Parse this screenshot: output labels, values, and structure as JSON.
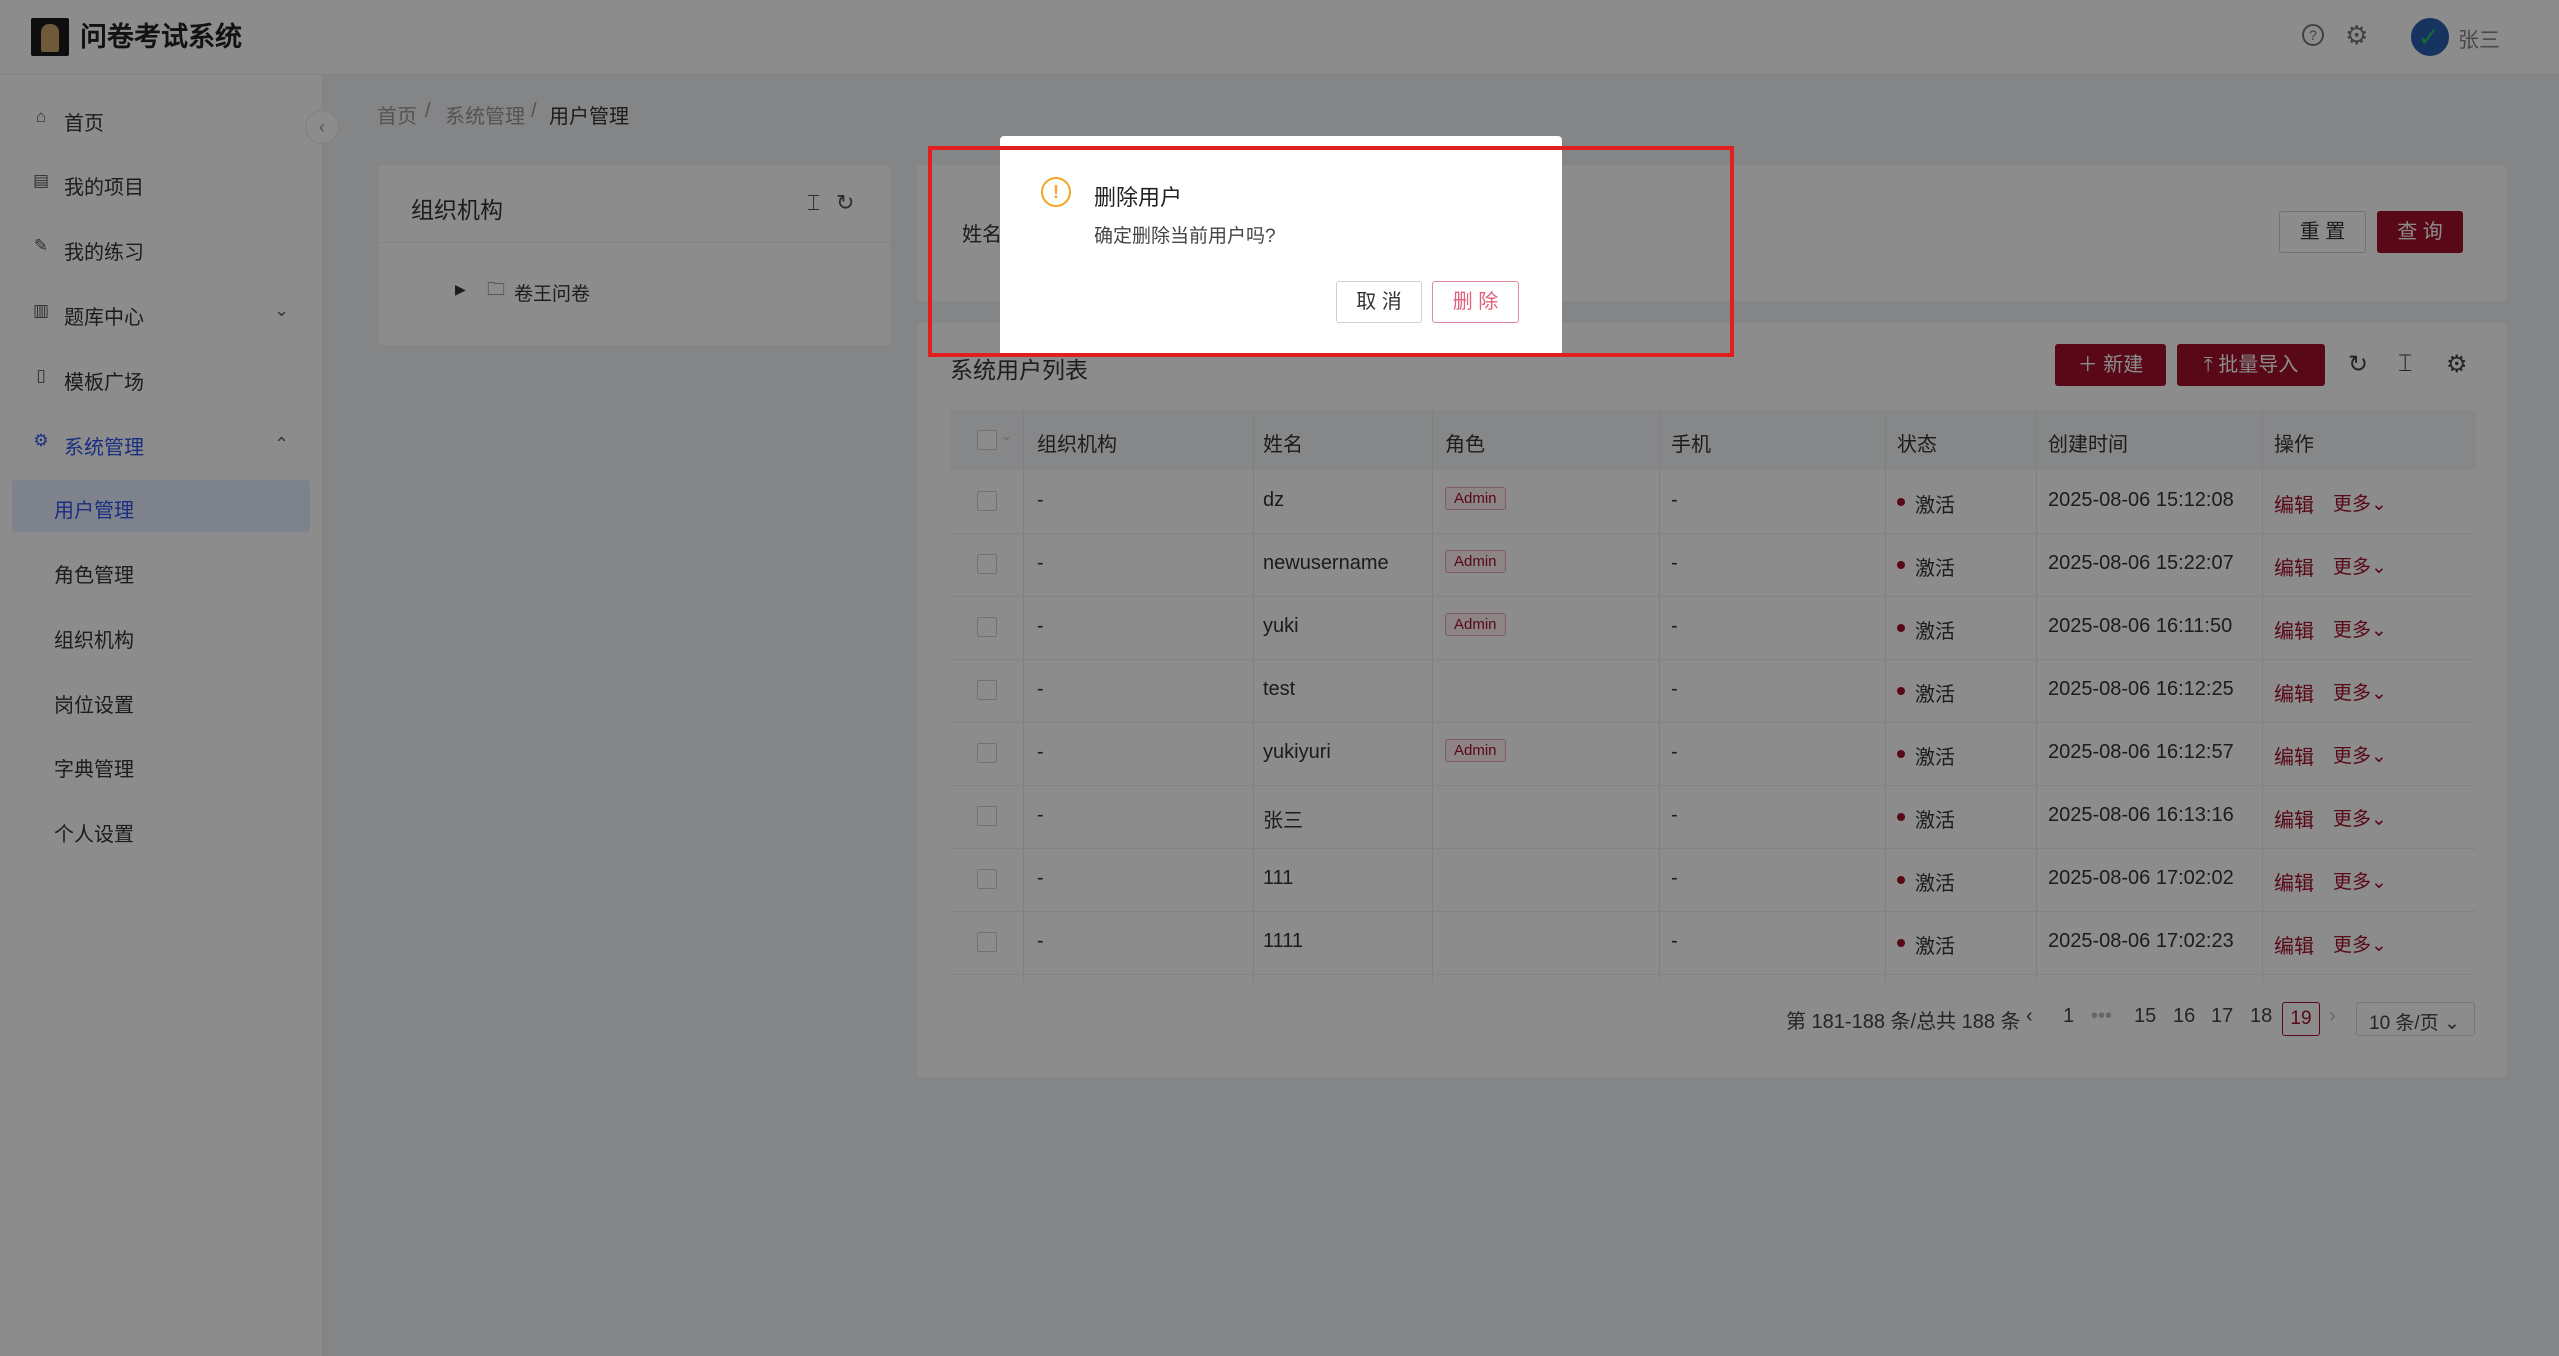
{
  "app": {
    "title": "问卷考试系统",
    "user": "张三"
  },
  "header": {
    "help_icon": "question-circle-icon",
    "settings_icon": "gear-icon"
  },
  "sidebar": {
    "collapse_icon": "‹",
    "items": [
      {
        "label": "首页",
        "icon": "home-icon"
      },
      {
        "label": "我的项目",
        "icon": "project-icon"
      },
      {
        "label": "我的练习",
        "icon": "edit-icon"
      },
      {
        "label": "题库中心",
        "icon": "book-icon"
      },
      {
        "label": "模板广场",
        "icon": "template-icon"
      },
      {
        "label": "系统管理",
        "icon": "settings-icon"
      }
    ],
    "sub_items": [
      "用户管理",
      "角色管理",
      "组织机构",
      "岗位设置",
      "字典管理",
      "个人设置"
    ]
  },
  "breadcrumb": [
    "首页",
    "系统管理",
    "用户管理"
  ],
  "org_panel": {
    "title": "组织机构",
    "tree_root": "卷王问卷"
  },
  "search": {
    "name_label": "姓名",
    "reset": "重 置",
    "query": "查 询"
  },
  "list": {
    "title": "系统用户列表",
    "new_button": "新建",
    "import_button": "批量导入",
    "columns": [
      "组织机构",
      "姓名",
      "角色",
      "手机",
      "状态",
      "创建时间",
      "操作"
    ],
    "rows": [
      {
        "org": "-",
        "name": "dz",
        "role": "Admin",
        "phone": "-",
        "status": "激活",
        "created": "2025-08-06 15:12:08",
        "edit": "编辑",
        "more": "更多"
      },
      {
        "org": "-",
        "name": "newusername",
        "role": "Admin",
        "phone": "-",
        "status": "激活",
        "created": "2025-08-06 15:22:07",
        "edit": "编辑",
        "more": "更多"
      },
      {
        "org": "-",
        "name": "yuki",
        "role": "Admin",
        "phone": "-",
        "status": "激活",
        "created": "2025-08-06 16:11:50",
        "edit": "编辑",
        "more": "更多"
      },
      {
        "org": "-",
        "name": "test",
        "role": "",
        "phone": "-",
        "status": "激活",
        "created": "2025-08-06 16:12:25",
        "edit": "编辑",
        "more": "更多"
      },
      {
        "org": "-",
        "name": "yukiyuri",
        "role": "Admin",
        "phone": "-",
        "status": "激活",
        "created": "2025-08-06 16:12:57",
        "edit": "编辑",
        "more": "更多"
      },
      {
        "org": "-",
        "name": "张三",
        "role": "",
        "phone": "-",
        "status": "激活",
        "created": "2025-08-06 16:13:16",
        "edit": "编辑",
        "more": "更多"
      },
      {
        "org": "-",
        "name": "111",
        "role": "",
        "phone": "-",
        "status": "激活",
        "created": "2025-08-06 17:02:02",
        "edit": "编辑",
        "more": "更多"
      },
      {
        "org": "-",
        "name": "1111",
        "role": "",
        "phone": "-",
        "status": "激活",
        "created": "2025-08-06 17:02:23",
        "edit": "编辑",
        "more": "更多"
      }
    ]
  },
  "pagination": {
    "summary": "第 181-188 条/总共 188 条",
    "pages": [
      "1",
      "•••",
      "15",
      "16",
      "17",
      "18"
    ],
    "current": "19",
    "page_size": "10 条/页"
  },
  "modal": {
    "title": "删除用户",
    "content": "确定删除当前用户吗?",
    "cancel": "取 消",
    "confirm": "删 除"
  },
  "colors": {
    "primary": "#a0102a",
    "link_active": "#2f54eb",
    "warning": "#f5a623",
    "highlight": "#e02020"
  }
}
